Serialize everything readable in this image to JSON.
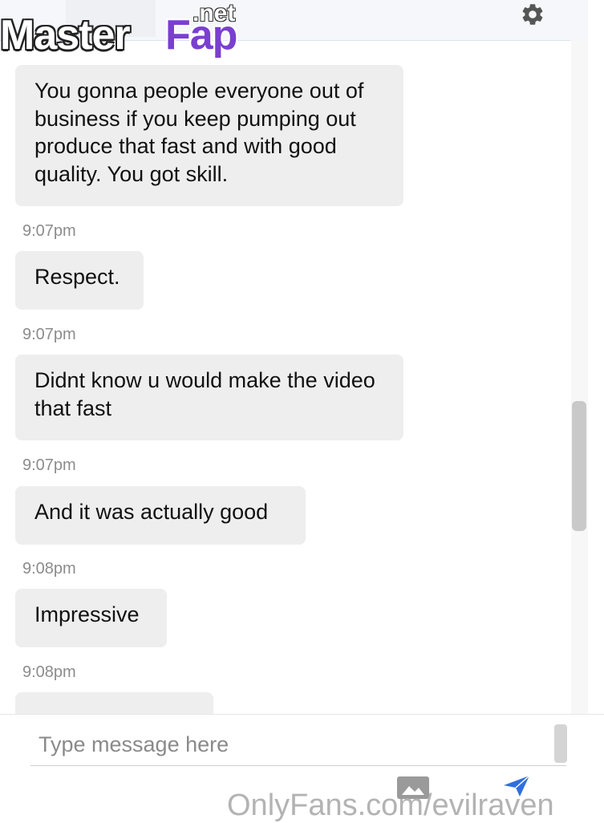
{
  "watermark": {
    "part1": "Master",
    "part2": "Fap",
    "part3": ".net"
  },
  "header": {
    "settings_icon": "gear-icon"
  },
  "messages": [
    {
      "text": "You gonna people everyone out of business if you keep pumping out produce that fast and with good quality. You got skill.",
      "time": "9:07pm"
    },
    {
      "text": "Respect.",
      "time": "9:07pm"
    },
    {
      "text": "Didnt know u would make the video that fast",
      "time": "9:07pm"
    },
    {
      "text": "And it was actually good",
      "time": "9:08pm"
    },
    {
      "text": "Impressive",
      "time": "9:08pm"
    }
  ],
  "composer": {
    "placeholder": "Type message here",
    "media_icon": "image-icon",
    "send_icon": "send-icon"
  },
  "footer_watermark": "OnlyFans.com/evilraven",
  "colors": {
    "bubble": "#eeeeee",
    "send": "#2f6fdc",
    "timestamp": "#8c8c8c"
  }
}
